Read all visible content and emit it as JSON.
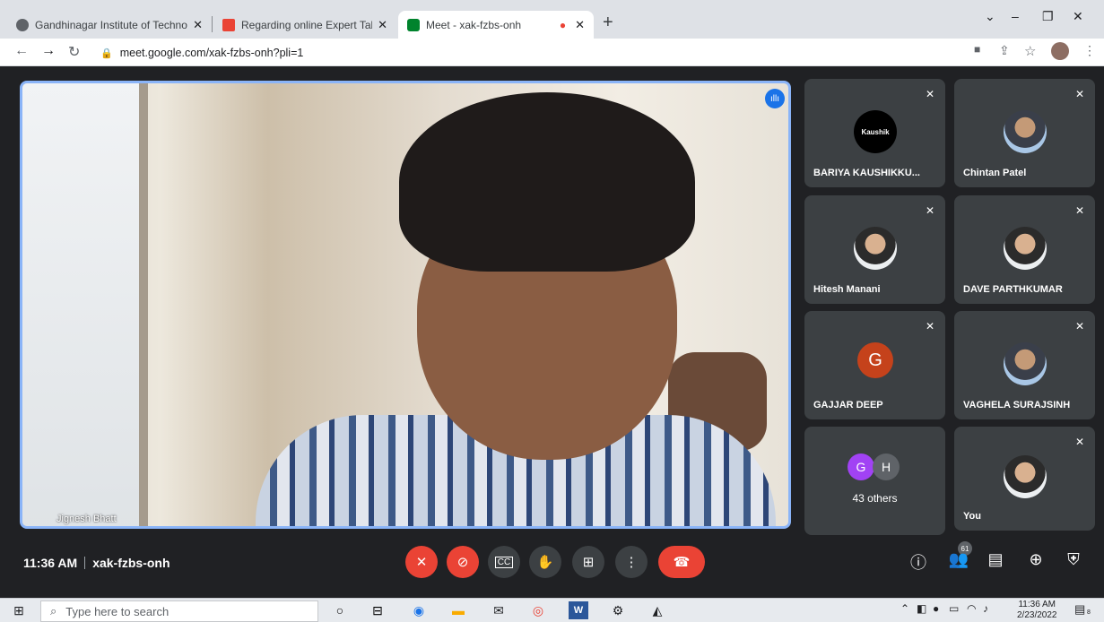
{
  "browser": {
    "tabs": [
      {
        "title": "Gandhinagar Institute of Technol",
        "icon": "globe-icon"
      },
      {
        "title": "Regarding online Expert Talk on",
        "icon": "gmail-icon"
      },
      {
        "title": "Meet - xak-fzbs-onh",
        "icon": "meet-icon"
      }
    ],
    "url": "meet.google.com/xak-fzbs-onh?pli=1",
    "new_tab": "+",
    "window_controls": [
      "⌄",
      "–",
      "❐",
      "✕"
    ]
  },
  "meet": {
    "main_speaker": "Jignesh Bhatt",
    "participants": [
      {
        "name": "BARIYA KAUSHIKKU...",
        "avatar_text": "Kaushik",
        "muted": true
      },
      {
        "name": "Chintan Patel",
        "avatar_text": "",
        "muted": true
      },
      {
        "name": "Hitesh Manani",
        "avatar_text": "",
        "muted": true
      },
      {
        "name": "DAVE PARTHKUMAR",
        "avatar_text": "",
        "muted": true
      },
      {
        "name": "GAJJAR DEEP",
        "avatar_text": "G",
        "muted": true
      },
      {
        "name": "VAGHELA SURAJSINH",
        "avatar_text": "",
        "muted": true
      },
      {
        "name": "You",
        "avatar_text": "",
        "muted": true
      }
    ],
    "others": {
      "label": "43 others",
      "initials": [
        "G",
        "H"
      ]
    },
    "time": "11:36 AM",
    "meeting_code": "xak-fzbs-onh",
    "participant_count": "61"
  },
  "taskbar": {
    "search_placeholder": "Type here to search",
    "time": "11:36 AM",
    "date": "2/23/2022",
    "notification_count": "8"
  }
}
